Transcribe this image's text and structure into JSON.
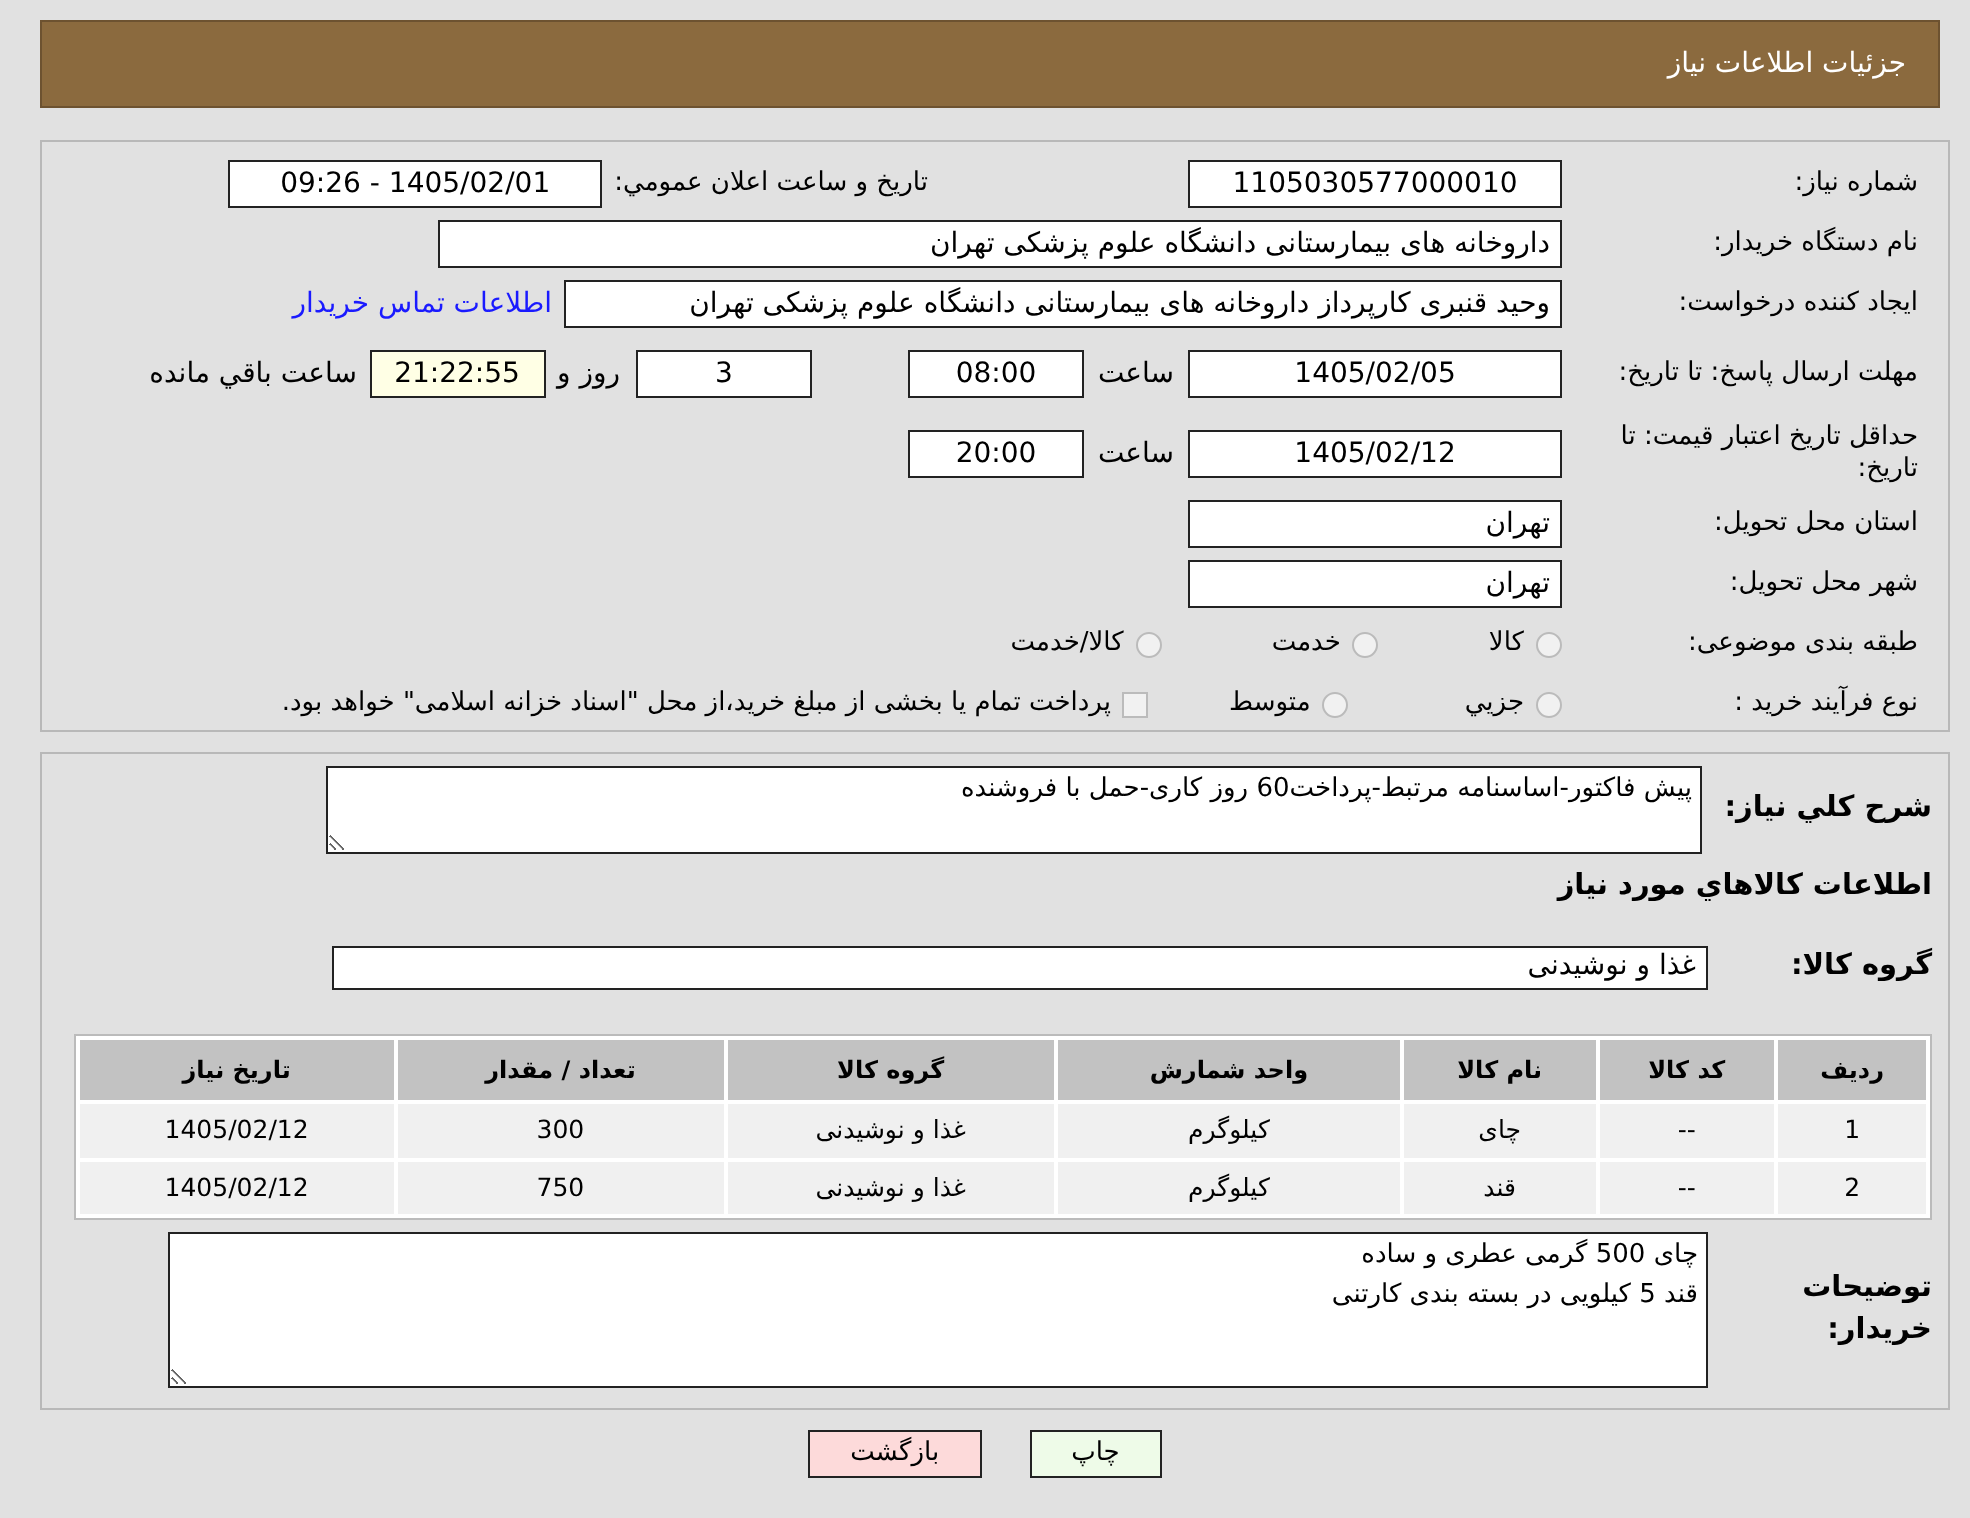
{
  "header": {
    "title": "جزئیات اطلاعات نیاز"
  },
  "need_number": {
    "label": "شماره نیاز:",
    "value": "1105030577000010"
  },
  "announce": {
    "label": "تاريخ و ساعت اعلان عمومي:",
    "value": "1405/02/01 - 09:26"
  },
  "buyer_org": {
    "label": "نام دستگاه خریدار:",
    "value": "داروخانه های بیمارستانی دانشگاه علوم پزشکی تهران"
  },
  "creator": {
    "label": "ایجاد کننده درخواست:",
    "value": "وحید قنبری کارپرداز داروخانه های بیمارستانی دانشگاه علوم پزشکی تهران",
    "link": "اطلاعات تماس خریدار"
  },
  "reply_deadline": {
    "label": "مهلت ارسال پاسخ: تا تاریخ:",
    "date": "1405/02/05",
    "time_label": "ساعت",
    "time": "08:00",
    "days": "3",
    "days_label": "روز و",
    "remaining": "21:22:55",
    "remaining_label": "ساعت باقي مانده"
  },
  "price_validity": {
    "label": "حداقل تاریخ اعتبار قیمت: تا تاریخ:",
    "date": "1405/02/12",
    "time_label": "ساعت",
    "time": "20:00"
  },
  "province": {
    "label": "استان محل تحویل:",
    "value": "تهران"
  },
  "city": {
    "label": "شهر محل تحویل:",
    "value": "تهران"
  },
  "category": {
    "label": "طبقه بندی موضوعی:",
    "options": [
      {
        "label": "کالا",
        "selected": false
      },
      {
        "label": "خدمت",
        "selected": false
      },
      {
        "label": "کالا/خدمت",
        "selected": false
      }
    ]
  },
  "purchase_type": {
    "label": "نوع فرآیند خرید :",
    "options": [
      {
        "label": "جزيي",
        "selected": false
      },
      {
        "label": "متوسط",
        "selected": false
      }
    ],
    "treasury": {
      "label": "پرداخت تمام یا بخشی از مبلغ خرید،از محل \"اسناد خزانه اسلامی\" خواهد بود.",
      "checked": false
    }
  },
  "description": {
    "label": "شرح كلي نياز:",
    "value": "پیش فاکتور-اساسنامه مرتبط-پرداخت60 روز کاری-حمل با فروشنده"
  },
  "goods_title": "اطلاعات كالاهاي مورد نياز",
  "goods_group": {
    "label": "گروه کالا:",
    "value": "غذا و نوشیدنی"
  },
  "table": {
    "columns": [
      "رديف",
      "کد کالا",
      "نام کالا",
      "واحد شمارش",
      "گروه کالا",
      "تعداد / مقدار",
      "تاریخ نیاز"
    ],
    "rows": [
      [
        "1",
        "--",
        "چای",
        "کیلوگرم",
        "غذا و نوشیدنی",
        "300",
        "1405/02/12"
      ],
      [
        "2",
        "--",
        "قند",
        "کیلوگرم",
        "غذا و نوشیدنی",
        "750",
        "1405/02/12"
      ]
    ]
  },
  "buyer_notes": {
    "label": "توضیحات خریدار:",
    "value": "چای 500 گرمی عطری و ساده\nقند 5 کیلویی در بسته بندی کارتنی"
  },
  "buttons": [
    {
      "label": "چاپ",
      "kind": "print"
    },
    {
      "label": "بازگشت",
      "kind": "back"
    }
  ]
}
